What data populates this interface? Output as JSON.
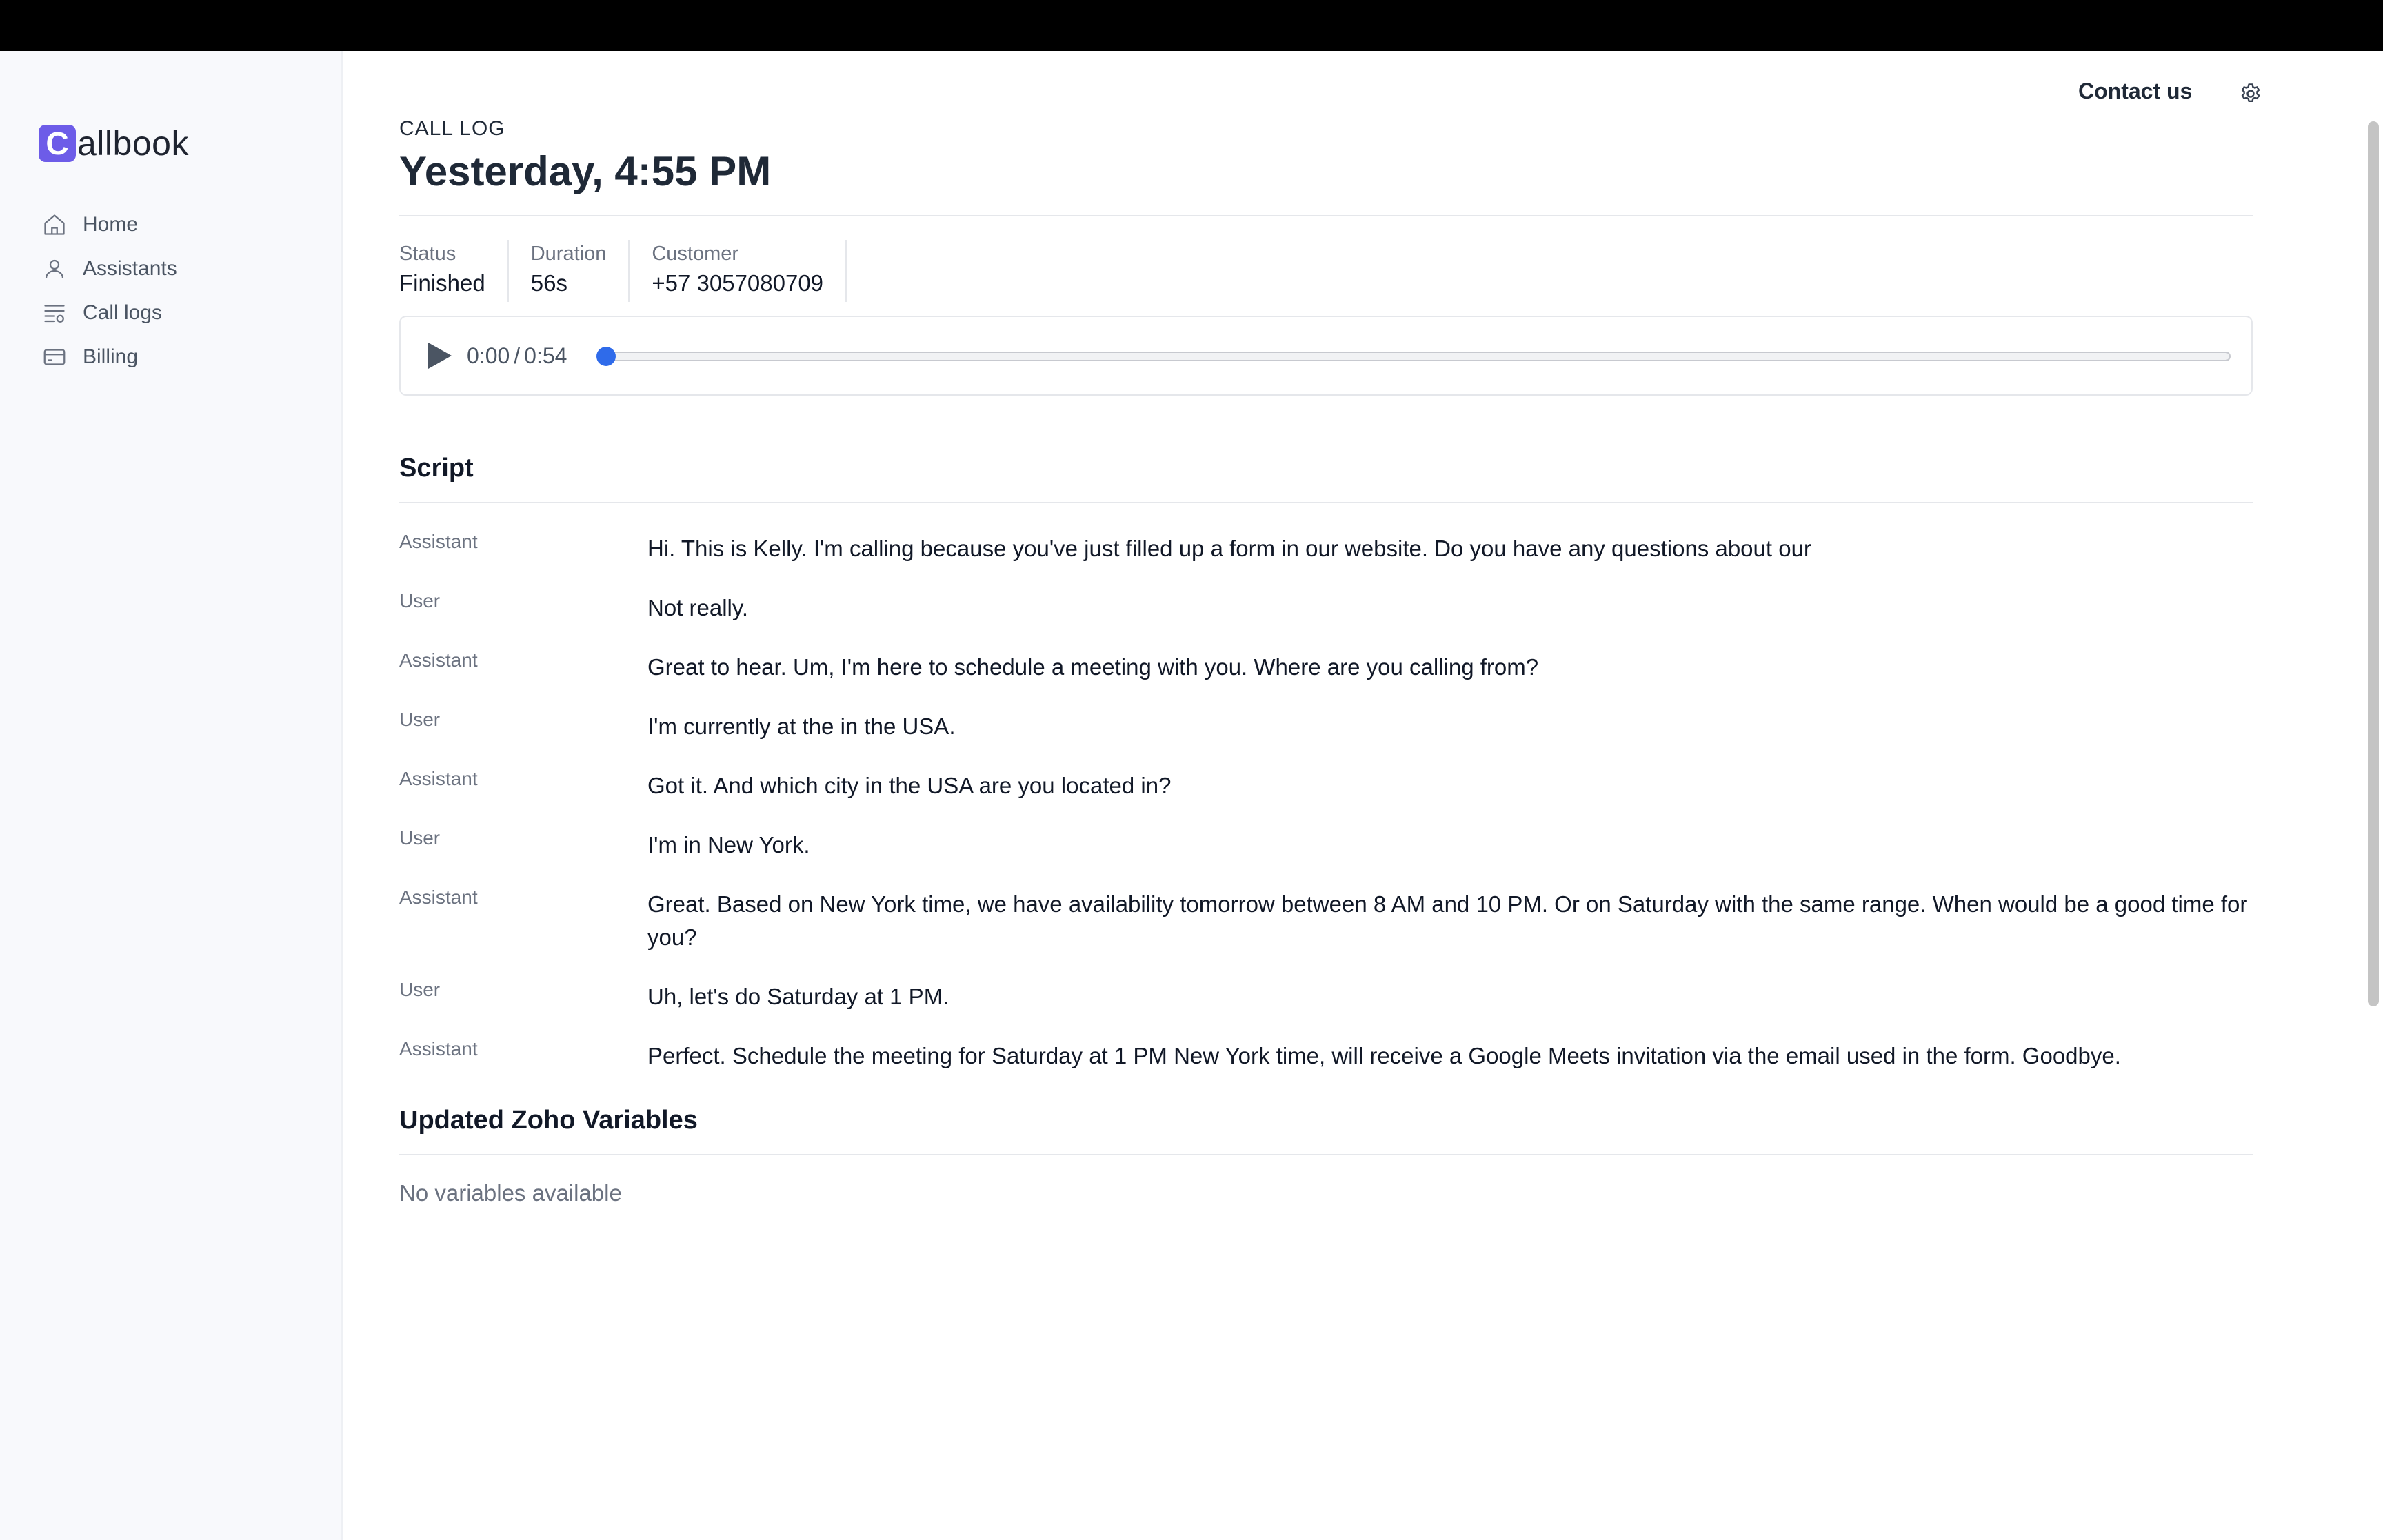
{
  "brand": {
    "logo_letter": "C",
    "logo_rest": "allbook",
    "accent_color": "#6d5ce8"
  },
  "sidebar": {
    "items": [
      {
        "label": "Home",
        "icon": "home-icon"
      },
      {
        "label": "Assistants",
        "icon": "user-icon"
      },
      {
        "label": "Call logs",
        "icon": "list-icon"
      },
      {
        "label": "Billing",
        "icon": "credit-card-icon"
      }
    ]
  },
  "header": {
    "contact_label": "Contact us",
    "settings_icon": "gear-icon"
  },
  "call": {
    "eyebrow": "CALL LOG",
    "title": "Yesterday, 4:55 PM",
    "status_label": "Status",
    "status_value": "Finished",
    "duration_label": "Duration",
    "duration_value": "56s",
    "customer_label": "Customer",
    "customer_value": "+57 3057080709"
  },
  "player": {
    "current_time": "0:00",
    "total_time": "0:54",
    "progress": 0,
    "accent_color": "#2563eb"
  },
  "script": {
    "title": "Script",
    "turns": [
      {
        "speaker": "Assistant",
        "text": "Hi. This is Kelly. I'm calling because you've just filled up a form in our website. Do you have any questions about our"
      },
      {
        "speaker": "User",
        "text": "Not really."
      },
      {
        "speaker": "Assistant",
        "text": "Great to hear. Um, I'm here to schedule a meeting with you. Where are you calling from?"
      },
      {
        "speaker": "User",
        "text": "I'm currently at the in the USA."
      },
      {
        "speaker": "Assistant",
        "text": "Got it. And which city in the USA are you located in?"
      },
      {
        "speaker": "User",
        "text": "I'm in New York."
      },
      {
        "speaker": "Assistant",
        "text": "Great. Based on New York time, we have availability tomorrow between 8 AM and 10 PM. Or on Saturday with the same range. When would be a good time for you?"
      },
      {
        "speaker": "User",
        "text": "Uh, let's do Saturday at 1 PM."
      },
      {
        "speaker": "Assistant",
        "text": "Perfect. Schedule the meeting for Saturday at 1 PM New York time, will receive a Google Meets invitation via the email used in the form. Goodbye."
      }
    ]
  },
  "variables": {
    "title": "Updated Zoho Variables",
    "empty_text": "No variables available"
  }
}
